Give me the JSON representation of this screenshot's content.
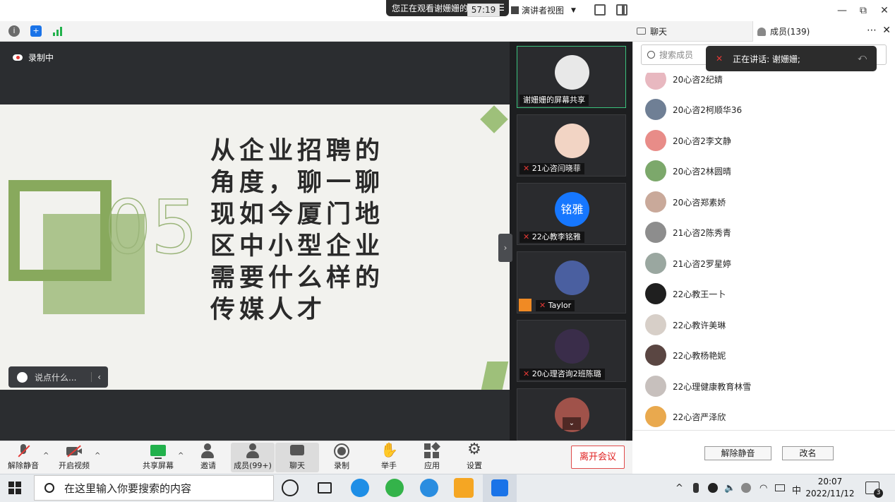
{
  "titlebar": {
    "viewing_label": "您正在观看谢姗姗的屏幕",
    "menu_icon": "hamburger-icon"
  },
  "meetbar": {
    "timer": "57:19",
    "view_mode": "演讲者视图"
  },
  "tabs": {
    "chat": "聊天",
    "members": "成员(139)"
  },
  "share": {
    "recording_label": "录制中",
    "slide_number": "05",
    "slide_title": "从企业招聘的角度，聊一聊现如今厦门地区中小型企业需要什么样的传媒人才",
    "chat_prompt": "说点什么..."
  },
  "gallery": [
    {
      "name": "谢姗姗的屏幕共享",
      "avatar_color": "#d9d9d9"
    },
    {
      "name": "21心咨闫晓菲",
      "avatar_color": "#f2d4c4"
    },
    {
      "name": "22心教李铭雅",
      "avatar_text": "铭雅",
      "avatar_color": "#1677ff"
    },
    {
      "name": "Taylor",
      "avatar_color": "#4a5fa0"
    },
    {
      "name": "20心理咨询2班陈璐",
      "avatar_color": "#3a2d4a"
    }
  ],
  "members_panel": {
    "search_placeholder": "搜索成员",
    "speaking_toast": "正在讲话: 谢姗姗;",
    "members": [
      {
        "name": "20心咨2纪婧",
        "avatar_color": "#e8b8c0"
      },
      {
        "name": "20心咨2柯顺华36",
        "avatar_color": "#6f7f95"
      },
      {
        "name": "20心咨2李文静",
        "avatar_color": "#e88c88"
      },
      {
        "name": "20心咨2林圆晴",
        "avatar_color": "#7ca86b"
      },
      {
        "name": "20心咨郑素娇",
        "avatar_color": "#c9a99a"
      },
      {
        "name": "21心咨2陈秀青",
        "avatar_color": "#8d8d8d"
      },
      {
        "name": "21心咨2罗星婷",
        "avatar_color": "#9aa7a0"
      },
      {
        "name": "22心教王一卜",
        "avatar_color": "#1f1f1f"
      },
      {
        "name": "22心教许美琳",
        "avatar_color": "#d7cfc8"
      },
      {
        "name": "22心教杨艳妮",
        "avatar_color": "#5a4642"
      },
      {
        "name": "22心理健康教育林雪",
        "avatar_color": "#c7c0bd"
      },
      {
        "name": "22心咨严泽欣",
        "avatar_color": "#e9a94e"
      }
    ],
    "unmute_button": "解除静音",
    "rename_button": "改名"
  },
  "controls": {
    "unmute": "解除静音",
    "start_video": "开启视频",
    "share_screen": "共享屏幕",
    "invite": "邀请",
    "members": "成员(99+)",
    "chat": "聊天",
    "record": "录制",
    "raise_hand": "举手",
    "apps": "应用",
    "settings": "设置",
    "leave": "离开会议"
  },
  "taskbar": {
    "search_placeholder": "在这里输入你要搜索的内容",
    "ime": "中",
    "time": "20:07",
    "date": "2022/11/12",
    "notification_count": "3"
  },
  "colors": {
    "accent_green": "#88a95d",
    "leave_red": "#e02020",
    "active_tile": "#3ac27c"
  }
}
